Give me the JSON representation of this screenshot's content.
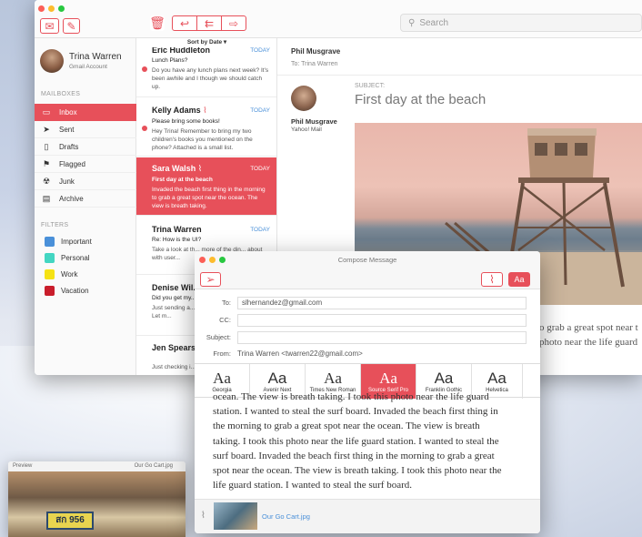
{
  "search": {
    "placeholder": "Search"
  },
  "account": {
    "name": "Trina Warren",
    "type": "Gmail Account"
  },
  "sidebar": {
    "mailboxes_heading": "MAILBOXES",
    "mailboxes": [
      {
        "label": "Inbox",
        "icon": "inbox-icon",
        "active": true
      },
      {
        "label": "Sent",
        "icon": "sent-icon"
      },
      {
        "label": "Drafts",
        "icon": "drafts-icon"
      },
      {
        "label": "Flagged",
        "icon": "flag-icon"
      },
      {
        "label": "Junk",
        "icon": "junk-icon"
      },
      {
        "label": "Archive",
        "icon": "archive-icon"
      }
    ],
    "filters_heading": "FILTERS",
    "filters": [
      {
        "label": "Important",
        "color": "#4a90d9"
      },
      {
        "label": "Personal",
        "color": "#43d6c2"
      },
      {
        "label": "Work",
        "color": "#f5e214"
      },
      {
        "label": "Vacation",
        "color": "#c91d2b"
      }
    ]
  },
  "list": {
    "sort_label": "Sort by Date",
    "messages": [
      {
        "from": "Eric Huddleton",
        "date": "TODAY",
        "subject": "Lunch Plans?",
        "preview": "Do you have any lunch plans next week? It's been awhile and I though we should catch up."
      },
      {
        "from": "Kelly Adams",
        "date": "TODAY",
        "subject": "Please bring some books!",
        "preview": "Hey Trina! Remember to bring my two children's books you mentioned on the phone? Attached is a small list."
      },
      {
        "from": "Sara Walsh",
        "date": "TODAY",
        "subject": "First day at the beach",
        "preview": "Invaded the beach first thing in the morning to grab a great spot near the ocean. The view is breath taking."
      },
      {
        "from": "Trina Warren",
        "date": "TODAY",
        "subject": "Re: How is the UI?",
        "preview": "Take a look at th... more of the din... about with user..."
      },
      {
        "from": "Denise Wil...",
        "date": "",
        "subject": "Did you get my...",
        "preview": "Just sending a... you received m... project. Let m..."
      },
      {
        "from": "Jen Spears",
        "date": "",
        "subject": "",
        "preview": "Just checking i..."
      }
    ]
  },
  "reader": {
    "header_from": "Phil Musgrave",
    "header_to": "To: Trina Warren",
    "sender_name": "Phil Musgrave",
    "sender_account": "Yahoo! Mail",
    "subject_label": "SUBJECT:",
    "subject": "First day at the beach",
    "body_line1": "o grab a great spot near t",
    "body_line2": "photo near the life guard"
  },
  "compose": {
    "title": "Compose Message",
    "to_label": "To:",
    "to_value": "slhernandez@gmail.com",
    "cc_label": "CC:",
    "cc_value": "",
    "subject_label": "Subject:",
    "subject_value": "",
    "from_label": "From:",
    "from_value": "Trina Warren <twarren22@gmail.com>",
    "format_button": "Aa",
    "fonts": [
      {
        "sample": "Aa",
        "name": "Georgia"
      },
      {
        "sample": "Aa",
        "name": "Avenir Next"
      },
      {
        "sample": "Aa",
        "name": "Times New Roman"
      },
      {
        "sample": "Aa",
        "name": "Source Serif Pro",
        "selected": true
      },
      {
        "sample": "Aa",
        "name": "Franklin Gothic"
      },
      {
        "sample": "Aa",
        "name": "Helvetica"
      }
    ],
    "body_lines": [
      "ocean. The view is breath taking. I took this photo near the life guard",
      "station.  I wanted to steal the surf board. Invaded the beach first thing in",
      "the morning to grab a great spot near the ocean.  The view is breath",
      "taking.  I took this photo near the life guard station.  I wanted to steal the",
      "surf board. Invaded the beach first thing in the morning to grab a great",
      "spot near the ocean.  The view is breath taking.  I took this photo near the",
      "life guard station.  I wanted to steal the surf board."
    ],
    "attachment_name": "Our Go Cart.jpg"
  },
  "preview": {
    "title": "Preview",
    "filename": "Our Go Cart.jpg",
    "plate_text": "สก 956"
  },
  "colors": {
    "accent": "#e7505a",
    "link": "#4a90d9"
  }
}
